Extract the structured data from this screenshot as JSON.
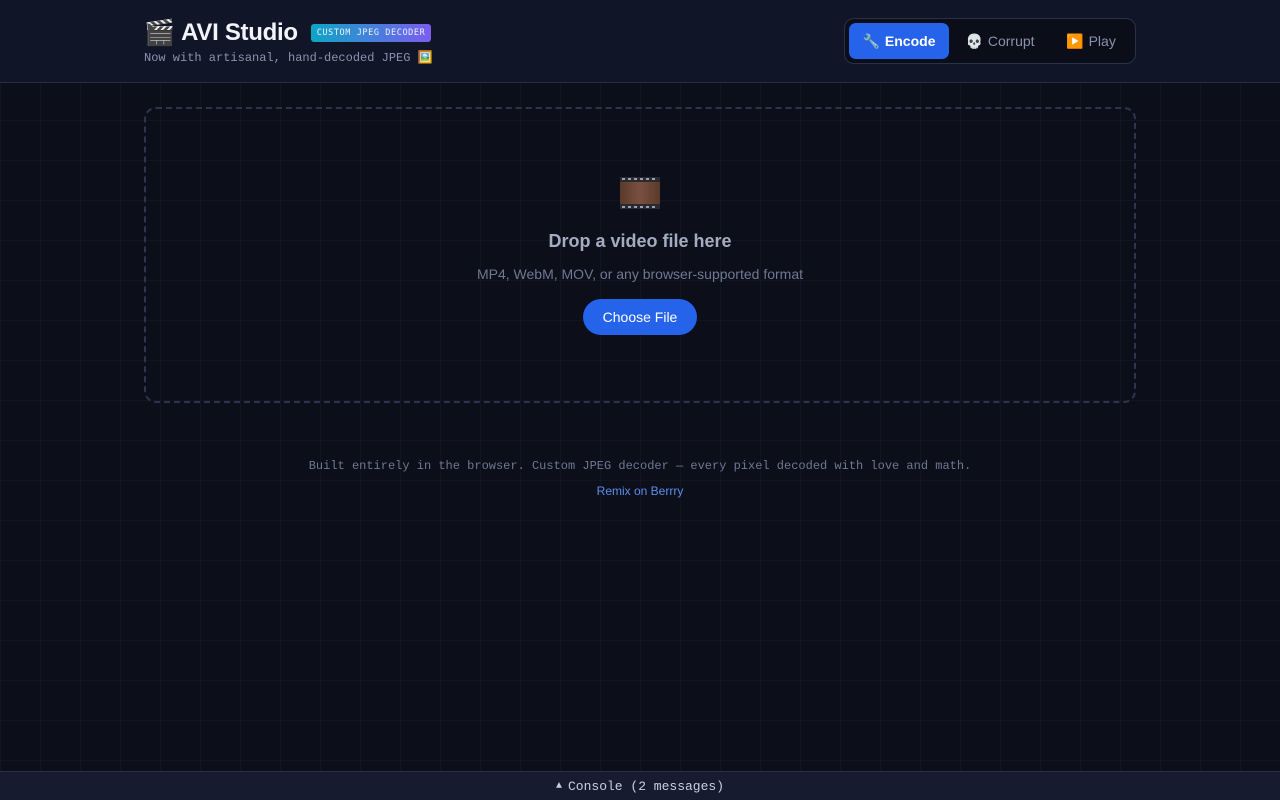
{
  "header": {
    "clapper_icon": "🎬",
    "title": "AVI Studio",
    "badge": "CUSTOM JPEG DECODER",
    "subtitle": "Now with artisanal, hand-decoded JPEG 🖼️"
  },
  "tabs": [
    {
      "icon": "🔧",
      "label": "Encode",
      "active": true
    },
    {
      "icon": "💀",
      "label": "Corrupt",
      "active": false
    },
    {
      "icon": "▶️",
      "label": "Play",
      "active": false
    }
  ],
  "dropzone": {
    "icon": "film-frames-icon",
    "title": "Drop a video file here",
    "subtitle": "MP4, WebM, MOV, or any browser-supported format",
    "button_label": "Choose File"
  },
  "footer": {
    "text": "Built entirely in the browser. Custom JPEG decoder — every pixel decoded with love and math.",
    "link": "Remix on Berrry"
  },
  "console": {
    "arrow": "▲",
    "label": "Console (2 messages)"
  },
  "colors": {
    "accent": "#2563eb",
    "background": "#0c0f1a",
    "link": "#5b8def"
  }
}
